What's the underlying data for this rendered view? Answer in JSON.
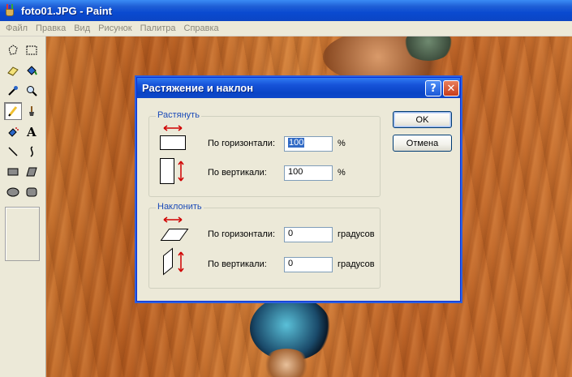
{
  "window": {
    "title": "foto01.JPG - Paint"
  },
  "menu": [
    "Файл",
    "Правка",
    "Вид",
    "Рисунок",
    "Палитра",
    "Справка"
  ],
  "toolbox": {
    "tools": [
      "free-select-icon",
      "rect-select-icon",
      "eraser-icon",
      "fill-icon",
      "color-picker-icon",
      "magnifier-icon",
      "pencil-icon",
      "brush-icon",
      "airbrush-icon",
      "text-icon",
      "line-icon",
      "curve-icon",
      "rectangle-icon",
      "polygon-icon",
      "ellipse-icon",
      "rounded-rect-icon"
    ],
    "active_tool": "pencil-icon"
  },
  "dialog": {
    "title": "Растяжение и наклон",
    "help_glyph": "?",
    "close_glyph": "✕",
    "stretch": {
      "label": "Растянуть",
      "horizontal_label": "По горизонтали:",
      "horizontal_value": "100",
      "horizontal_unit": "%",
      "vertical_label": "По вертикали:",
      "vertical_value": "100",
      "vertical_unit": "%"
    },
    "skew": {
      "label": "Наклонить",
      "horizontal_label": "По горизонтали:",
      "horizontal_value": "0",
      "horizontal_unit": "градусов",
      "vertical_label": "По вертикали:",
      "vertical_value": "0",
      "vertical_unit": "градусов"
    },
    "ok_label": "OK",
    "cancel_label": "Отмена"
  },
  "colors": {
    "title_blue": "#0a44c6",
    "dialog_bg": "#ece9d8",
    "group_label": "#1a4ab8",
    "arrow_red": "#d00000"
  }
}
